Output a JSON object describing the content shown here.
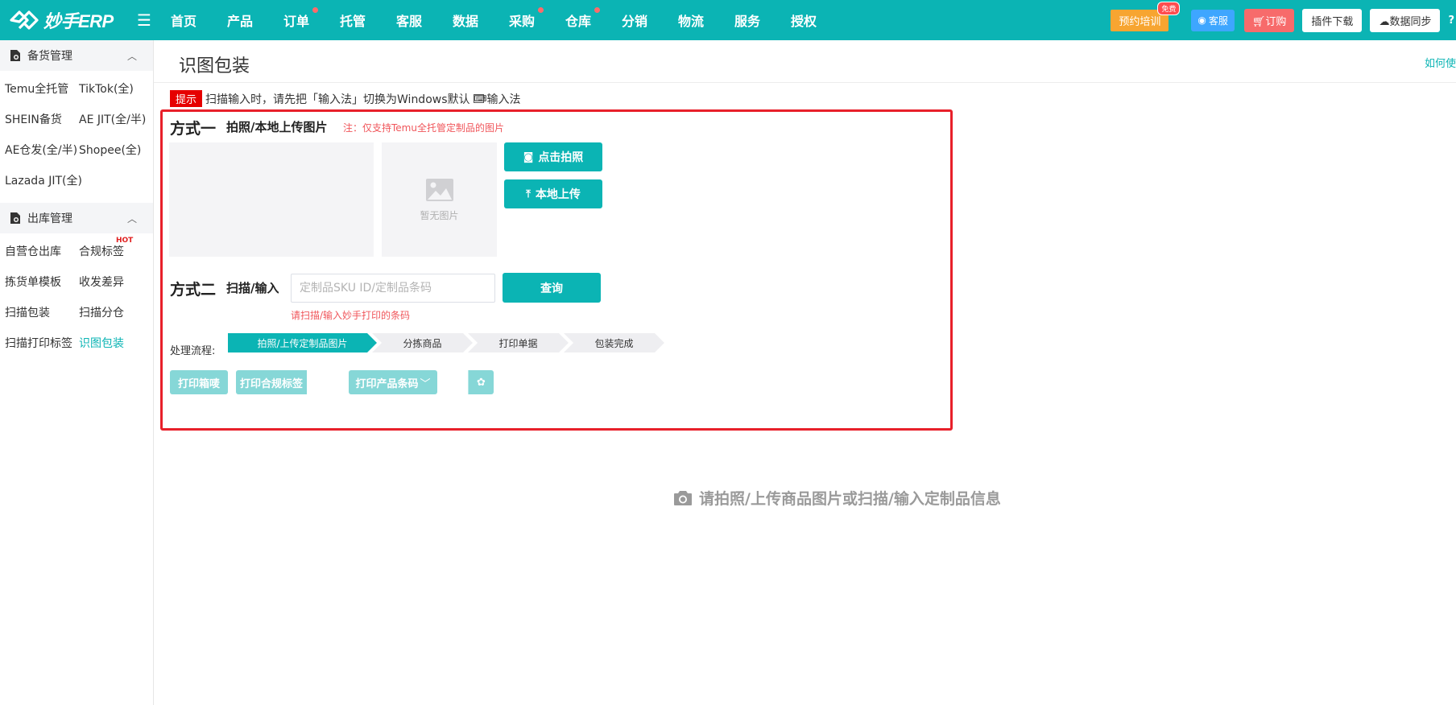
{
  "brand": {
    "name": "妙手ERP"
  },
  "nav": {
    "items": [
      {
        "label": "首页",
        "dot": false
      },
      {
        "label": "产品",
        "dot": false
      },
      {
        "label": "订单",
        "dot": true
      },
      {
        "label": "托管",
        "dot": false
      },
      {
        "label": "客服",
        "dot": false
      },
      {
        "label": "数据",
        "dot": false
      },
      {
        "label": "采购",
        "dot": true
      },
      {
        "label": "仓库",
        "dot": true
      },
      {
        "label": "分销",
        "dot": false
      },
      {
        "label": "物流",
        "dot": false
      },
      {
        "label": "服务",
        "dot": false
      },
      {
        "label": "授权",
        "dot": false
      }
    ],
    "training": "预约培训",
    "training_badge": "免费",
    "service": "客服",
    "order": "订购",
    "plugin": "插件下载",
    "sync": "数据同步",
    "help": "?"
  },
  "sidebar": {
    "groups": [
      {
        "title": "备货管理",
        "items": [
          "Temu全托管",
          "TikTok(全)",
          "SHEIN备货",
          "AE JIT(全/半)",
          "AE仓发(全/半)",
          "Shopee(全)",
          "Lazada JIT(全)"
        ]
      },
      {
        "title": "出库管理",
        "items": [
          "自营仓出库",
          "合规标签",
          "拣货单模板",
          "收发差异",
          "扫描包装",
          "扫描分仓",
          "扫描打印标签",
          "识图包装"
        ]
      }
    ],
    "hot_label": "HOT"
  },
  "page": {
    "title": "识图包装",
    "how_to": "如何使",
    "tip_badge": "提示",
    "tip_text_1": "扫描输入时，请先把「输入法」切换为Windows默认",
    "tip_text_2": "输入法",
    "method1": {
      "title": "方式一",
      "subtitle": "拍照/本地上传图片",
      "note": "注：仅支持Temu全托管定制品的图片",
      "no_image": "暂无图片",
      "take_photo": "点击拍照",
      "upload": "本地上传"
    },
    "method2": {
      "title": "方式二",
      "subtitle": "扫描/输入",
      "placeholder": "定制品SKU ID/定制品条码",
      "value": "",
      "query": "查询",
      "hint": "请扫描/输入妙手打印的条码"
    },
    "flow": {
      "label": "处理流程:",
      "steps": [
        "拍照/上传定制品图片",
        "分拣商品",
        "打印单据",
        "包装完成"
      ]
    },
    "actions": {
      "print_mark": "打印箱唛",
      "print_label": "打印合规标签",
      "print_barcode": "打印产品条码"
    },
    "empty_hint": "请拍照/上传商品图片或扫描/输入定制品信息"
  },
  "colors": {
    "brand": "#0bb4b4",
    "alert": "#e8202a",
    "order": "#f76b6b",
    "training": "#f7a531",
    "service": "#3ea6ff"
  }
}
